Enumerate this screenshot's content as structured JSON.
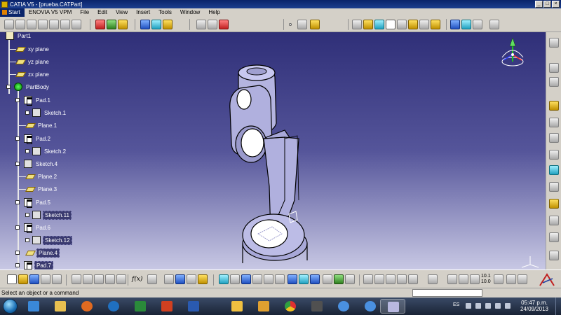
{
  "window": {
    "title": "CATIA V5 - [prueba.CATPart]",
    "min_label": "_",
    "max_label": "□",
    "close_label": "×"
  },
  "menu": {
    "items": [
      "Start",
      "ENOVIA V5 VPM",
      "File",
      "Edit",
      "View",
      "Insert",
      "Tools",
      "Window",
      "Help"
    ]
  },
  "tree": {
    "nodes": [
      {
        "label": "Part1",
        "type": "part"
      },
      {
        "label": "xy plane",
        "type": "plane"
      },
      {
        "label": "yz plane",
        "type": "plane"
      },
      {
        "label": "zx plane",
        "type": "plane"
      },
      {
        "label": "PartBody",
        "type": "body"
      },
      {
        "label": "Pad.1",
        "type": "pad"
      },
      {
        "label": "Sketch.1",
        "type": "sketch"
      },
      {
        "label": "Plane.1",
        "type": "plane"
      },
      {
        "label": "Pad.2",
        "type": "pad"
      },
      {
        "label": "Sketch.2",
        "type": "sketch"
      },
      {
        "label": "Sketch.4",
        "type": "sketch"
      },
      {
        "label": "Plane.2",
        "type": "plane"
      },
      {
        "label": "Plane.3",
        "type": "plane"
      },
      {
        "label": "Pad.5",
        "type": "pad"
      },
      {
        "label": "Sketch.11",
        "type": "sketch"
      },
      {
        "label": "Pad.6",
        "type": "pad"
      },
      {
        "label": "Sketch.12",
        "type": "sketch"
      },
      {
        "label": "Plane.4",
        "type": "plane"
      },
      {
        "label": "Pad.7",
        "type": "pad"
      }
    ]
  },
  "toolbar": {
    "fx_label": "f(x)",
    "scale_label": "10.1\n10.0"
  },
  "status": {
    "message": "Select an object or a command"
  },
  "taskbar": {
    "language": "ES",
    "time": "05:47 p.m.",
    "date": "24/09/2013"
  },
  "colors": {
    "viewport_top": "#2f2f78",
    "viewport_bottom": "#c8c8e4",
    "part_fill": "#b8b8e0",
    "part_edge": "#000000",
    "tree_text": "#ffffff"
  },
  "icons": [
    "catia-logo-icon",
    "compass-icon",
    "axis-icon",
    "windows-orb-icon",
    "chrome-icon",
    "excel-icon",
    "word-icon",
    "powerpoint-icon",
    "itunes-icon"
  ]
}
